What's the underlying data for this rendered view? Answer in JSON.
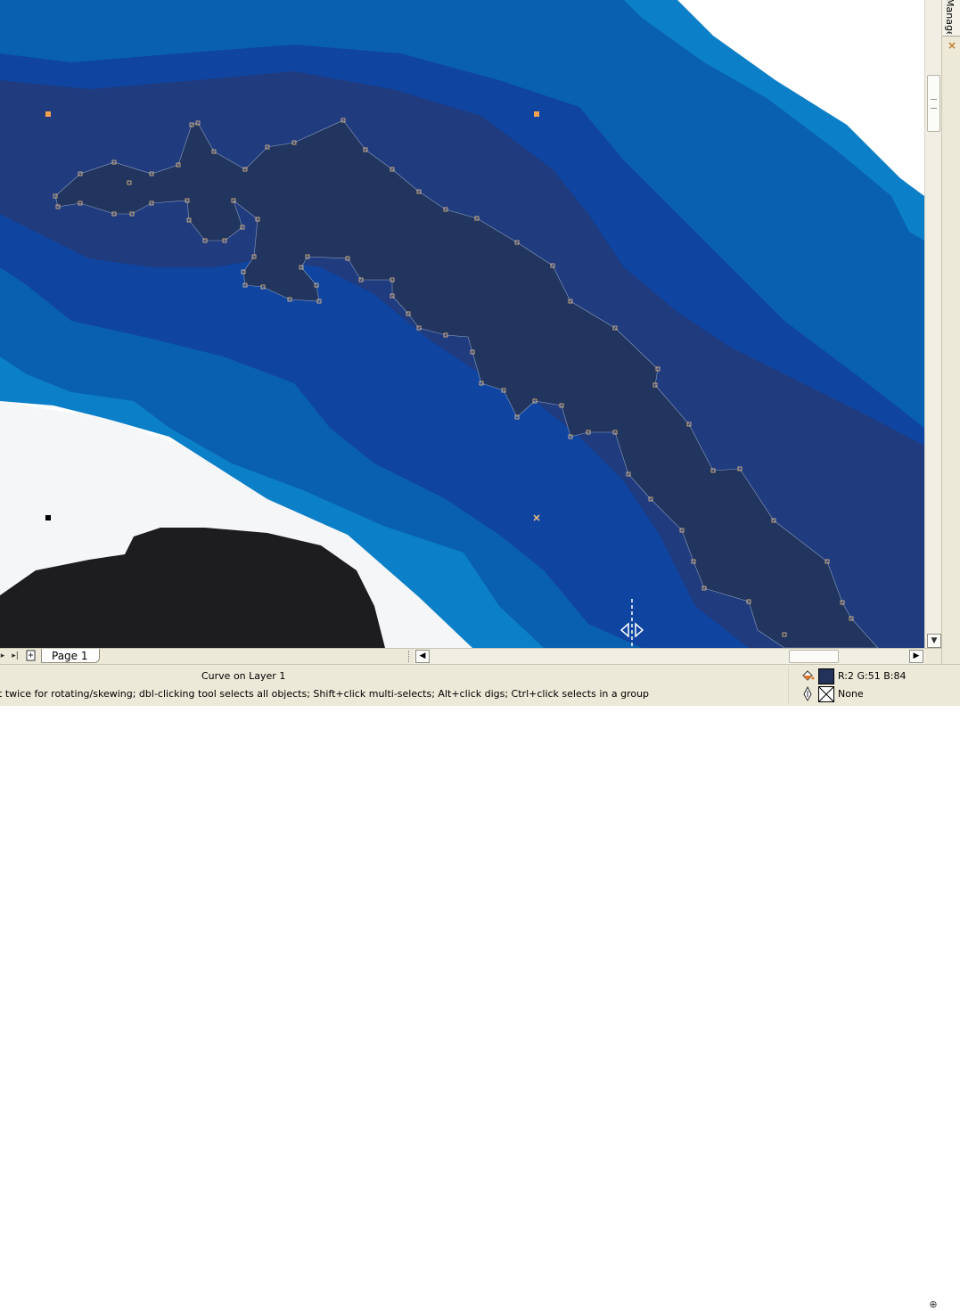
{
  "docker": {
    "tab_label": "Manager",
    "close_glyph": "×"
  },
  "canvas": {
    "colors": {
      "paper": "#f5f6f8",
      "light_blue": "#0b7fc8",
      "mid_blue": "#0a60b0",
      "blue": "#0f45a0",
      "navy": "#203b7e",
      "dark_navy": "#22355e",
      "black_shape": "#1d1d1f",
      "node": "#f1c282",
      "node_selected": "#f2a14f"
    },
    "cursor": "horizontal-skew-arrows"
  },
  "page_bar": {
    "page_tab_label": "Page 1",
    "nav_prev_icon": "prev-page-icon",
    "nav_last_icon": "last-page-icon",
    "add_page_icon": "add-page-icon"
  },
  "status": {
    "object_info": "Curve on Layer 1",
    "hint": "ct twice for rotating/skewing; dbl-clicking tool selects all objects; Shift+click multi-selects; Alt+click digs; Ctrl+click selects in a group",
    "fill_label": "R:2 G:51 B:84",
    "fill_color": "#223259",
    "outline_label": "None"
  }
}
